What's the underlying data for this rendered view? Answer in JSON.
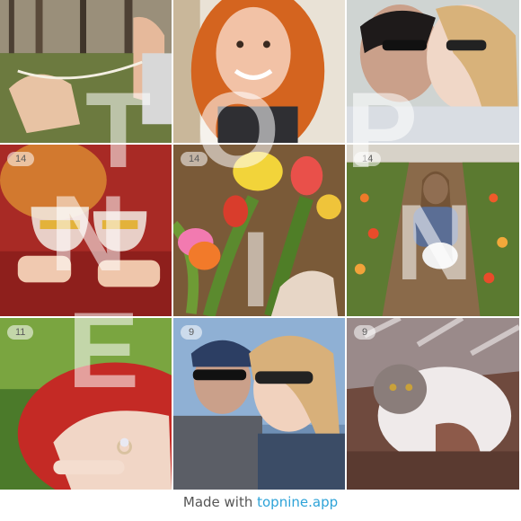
{
  "tiles": [
    {
      "badge": ""
    },
    {
      "badge": ""
    },
    {
      "badge": ""
    },
    {
      "badge": "14"
    },
    {
      "badge": "14"
    },
    {
      "badge": "14"
    },
    {
      "badge": "11"
    },
    {
      "badge": "9"
    },
    {
      "badge": "9"
    }
  ],
  "overlay_letters": [
    "T",
    "O",
    "P",
    "N",
    "I",
    "N",
    "E"
  ],
  "footer": {
    "prefix": "Made with ",
    "link": "topnine.app"
  },
  "colors": {
    "link": "#2ea3d8",
    "footer_text": "#555555"
  }
}
